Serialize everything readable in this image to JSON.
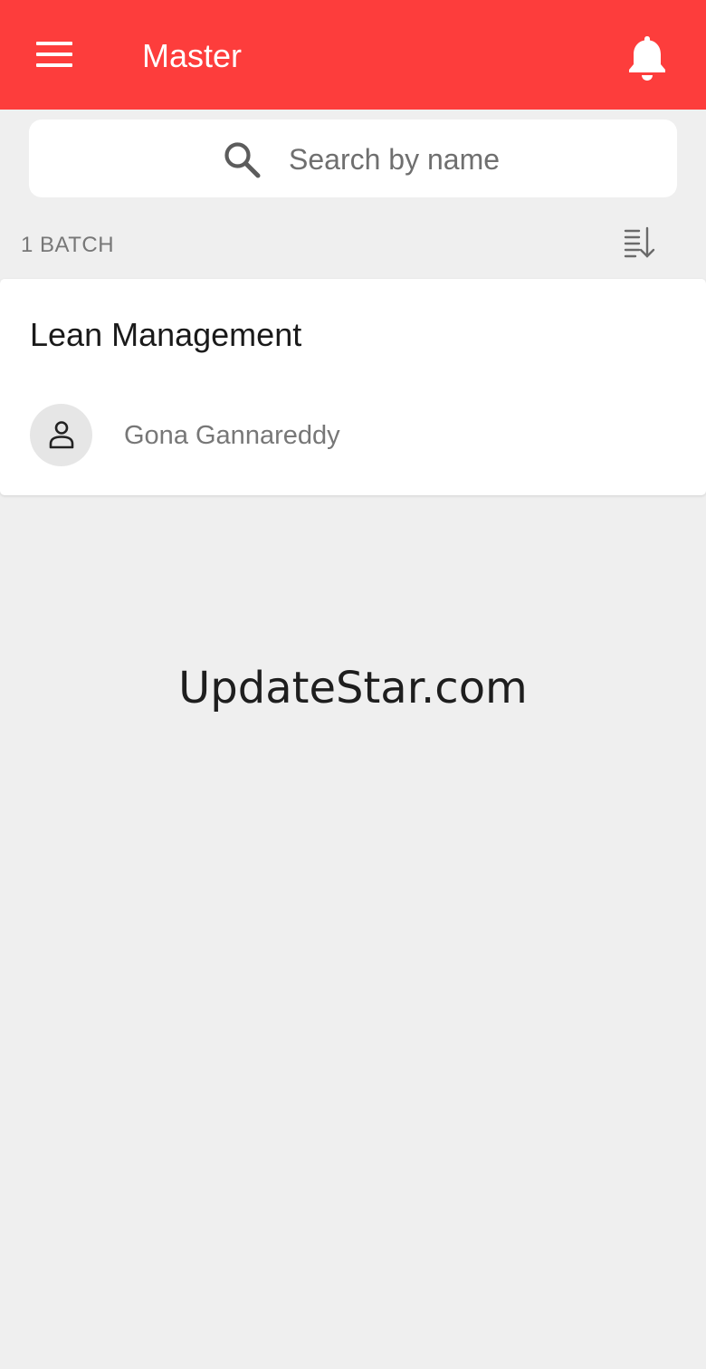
{
  "app_bar": {
    "title": "Master",
    "background_color": "#fd3d3c",
    "menu_icon": "hamburger-menu-icon",
    "notification_icon": "bell-icon"
  },
  "search": {
    "placeholder": "Search by name",
    "value": "",
    "icon": "search-icon"
  },
  "list_header": {
    "count_label": "1 BATCH",
    "sort_icon": "sort-descending-icon"
  },
  "batches": [
    {
      "title": "Lean Management",
      "person_icon": "person-icon",
      "person_name": "Gona Gannareddy"
    }
  ],
  "watermark": "UpdateStar.com"
}
